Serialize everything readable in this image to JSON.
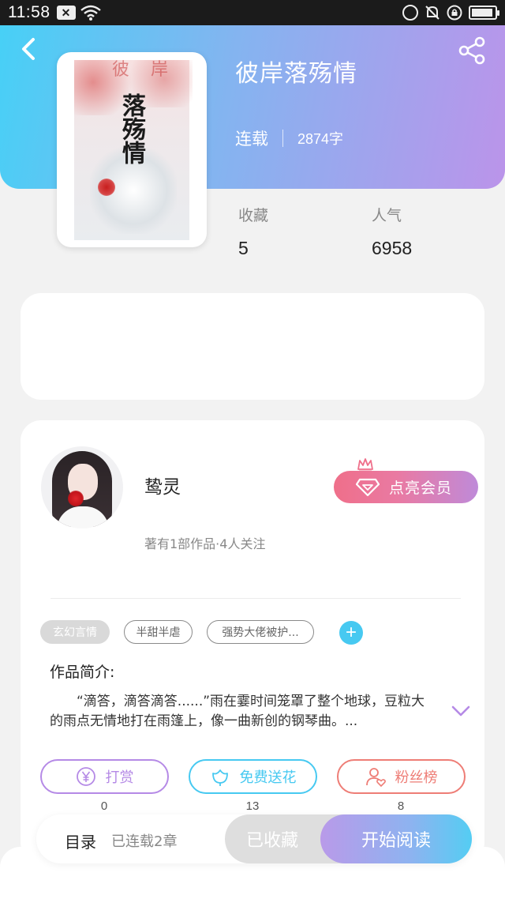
{
  "status_bar": {
    "time": "11:58",
    "badge": "✕"
  },
  "book": {
    "title": "彼岸落殇情",
    "status": "连载",
    "word_count": "2874字",
    "cover_top_text": "彼 岸",
    "cover_title": "落殇情"
  },
  "stats": {
    "favorites_label": "收藏",
    "favorites_value": "5",
    "popularity_label": "人气",
    "popularity_value": "6958"
  },
  "author": {
    "name": "鸷灵",
    "subtitle": "著有1部作品·4人关注",
    "vip_button": "点亮会员"
  },
  "tags": [
    "玄幻言情",
    "半甜半虐",
    "强势大佬被护..."
  ],
  "intro": {
    "title": "作品简介:",
    "text": "“滴答，滴答滴答......”雨在霎时间笼罩了整个地球，豆粒大的雨点无情地打在雨篷上，像一曲新创的钢琴曲。..."
  },
  "actions": [
    {
      "label": "打赏",
      "count": "0",
      "color": "#b58ae6",
      "icon": "yen-icon"
    },
    {
      "label": "免费送花",
      "count": "13",
      "color": "#47c9f1",
      "icon": "flower-icon"
    },
    {
      "label": "粉丝榜",
      "count": "8",
      "color": "#ee7d76",
      "icon": "fans-icon"
    }
  ],
  "bottom_bar": {
    "toc_label": "目录",
    "toc_count": "已连载2章",
    "favorited_label": "已收藏",
    "read_label": "开始阅读"
  },
  "colors": {
    "header_start": "#47d0f6",
    "header_end": "#bb94ea",
    "accent_blue": "#47c9f1",
    "vip_pink": "#ef6f8a"
  }
}
